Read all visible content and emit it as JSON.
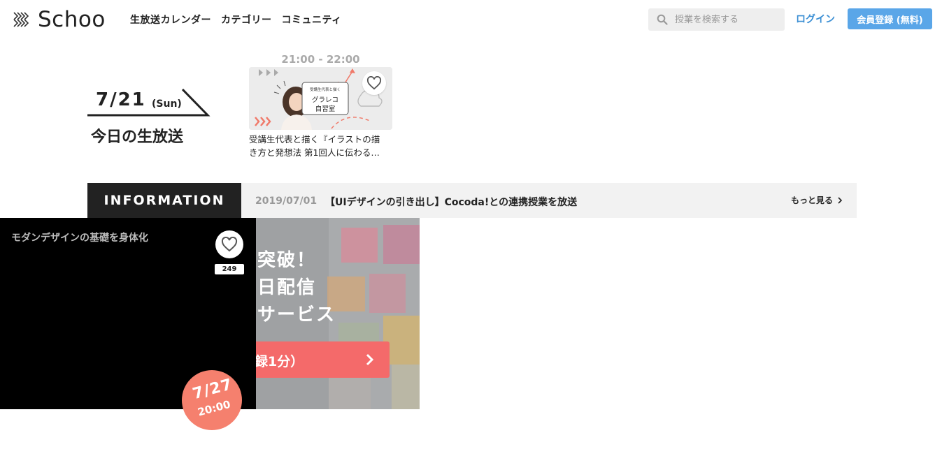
{
  "header": {
    "logo_text": "Schoo",
    "nav": [
      "生放送カレンダー",
      "カテゴリー",
      "コミュニティ"
    ],
    "search_placeholder": "授業を検索する",
    "login_label": "ログイン",
    "signup_label": "会員登録 (無料)"
  },
  "today": {
    "date": "7/21",
    "day_of_week": "(Sun)",
    "label": "今日の生放送"
  },
  "live_class": {
    "time": "21:00 - 22:00",
    "thumbnail_caption_small": "受講生代表と描く",
    "thumbnail_caption_1": "グラレコ",
    "thumbnail_caption_2": "自習室",
    "title_line1": "受講生代表と描く『イラストの描",
    "title_line2": "き方と発想法 第1回人に伝わる…"
  },
  "information": {
    "label": "INFORMATION",
    "date": "2019/07/01",
    "title": "【UIデザインの引き出し】Cocoda!との連携授業を放送",
    "more_label": "もっと見る"
  },
  "promo": {
    "line1": "突破！",
    "line2": "日配信",
    "line3": "サービス",
    "cta_label": "録1分）"
  },
  "video": {
    "title": "モダンデザインの基礎を身体化",
    "like_count": "249",
    "badge_date": "7/27",
    "badge_time": "20:00"
  },
  "colors": {
    "link_blue": "#3b8fd4",
    "signup_blue": "#5aa6e8",
    "cta_red": "#f46a6a",
    "badge_coral": "#f5806e"
  }
}
